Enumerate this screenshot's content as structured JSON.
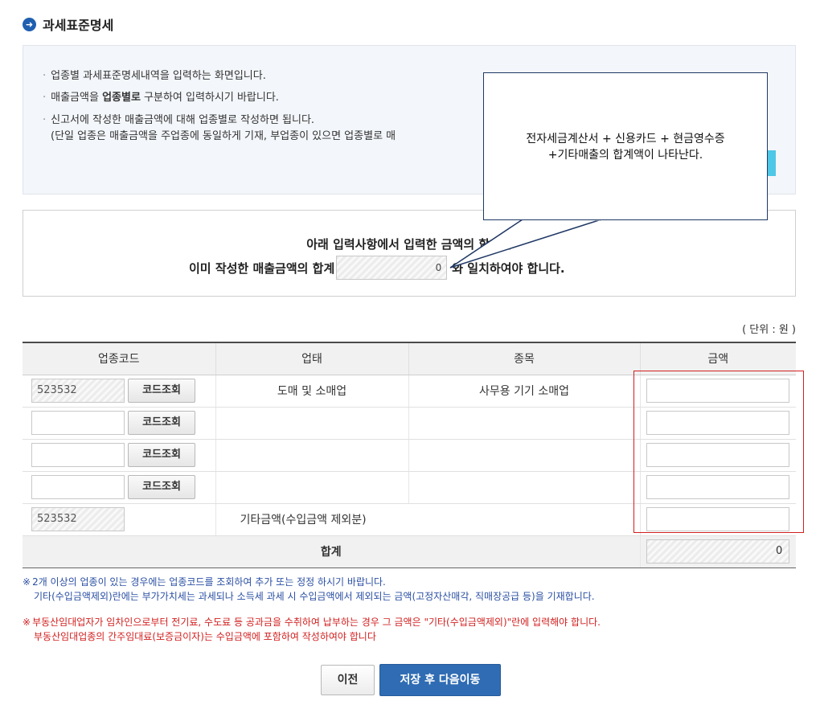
{
  "header": {
    "title": "과세표준명세",
    "icon": "arrow-circle-icon"
  },
  "info": {
    "lines": [
      "업종별 과세표준명세내역을 입력하는 화면입니다.",
      "매출금액을 ",
      "신고서에 작성한 매출금액에 대해 업종별로 작성하면 됩니다.",
      "(단일 업종은 매출금액을 주업종에 동일하게 기재, 부업종이 있으면 업종별로 매"
    ],
    "line2_bold": "업종별로",
    "line2_tail": " 구분하여 입력하시기 바랍니다."
  },
  "callout": {
    "line1": "전자세금계산서 + 신용카드 + 현금영수증",
    "line2": "+기타매출의 합계액이 나타난다."
  },
  "notice": {
    "line1": "아래 입력사항에서  입력한 금액의 합계는",
    "line2_before": "이미 작성한 매출금액의 합계",
    "line2_value": "0",
    "line2_after": "와 일치하여야 합니다."
  },
  "unit_label": "( 단위 : 원 )",
  "table": {
    "headers": [
      "업종코드",
      "업태",
      "종목",
      "금액"
    ],
    "code_button_label": "코드조회",
    "rows": [
      {
        "code": "523532",
        "business_type": "도매 및 소매업",
        "item": "사무용 기기 소매업"
      },
      {
        "code": "",
        "business_type": "",
        "item": ""
      },
      {
        "code": "",
        "business_type": "",
        "item": ""
      },
      {
        "code": "",
        "business_type": "",
        "item": ""
      }
    ],
    "other_row": {
      "code": "523532",
      "label": "기타금액(수입금액 제외분)"
    },
    "total_label": "합계",
    "total_value": "0"
  },
  "notes": {
    "blue_line1": "2개 이상의 업종이 있는 경우에는 업종코드를 조회하여 추가 또는 정정 하시기 바랍니다.",
    "blue_line2": "기타(수입금액제외)란에는 부가가치세는 과세되나 소득세 과세 시 수입금액에서 제외되는 금액(고정자산매각, 직매장공급 등)을 기재합니다.",
    "red_line1": "부동산임대업자가 임차인으로부터 전기료, 수도료 등 공과금을 수취하여 납부하는 경우 그 금액은 \"기타(수입금액제외)\"란에 입력해야 합니다.",
    "red_line2": "부동산임대업종의 간주임대료(보증금이자)는 수입금액에 포함하여 작성하여야 합니다",
    "mark": "※"
  },
  "buttons": {
    "prev": "이전",
    "save_next": "저장 후 다음이동"
  },
  "colors": {
    "accent_blue": "#2f6cb3",
    "highlight_red": "#d21f1f",
    "callout_border": "#1f3864"
  }
}
